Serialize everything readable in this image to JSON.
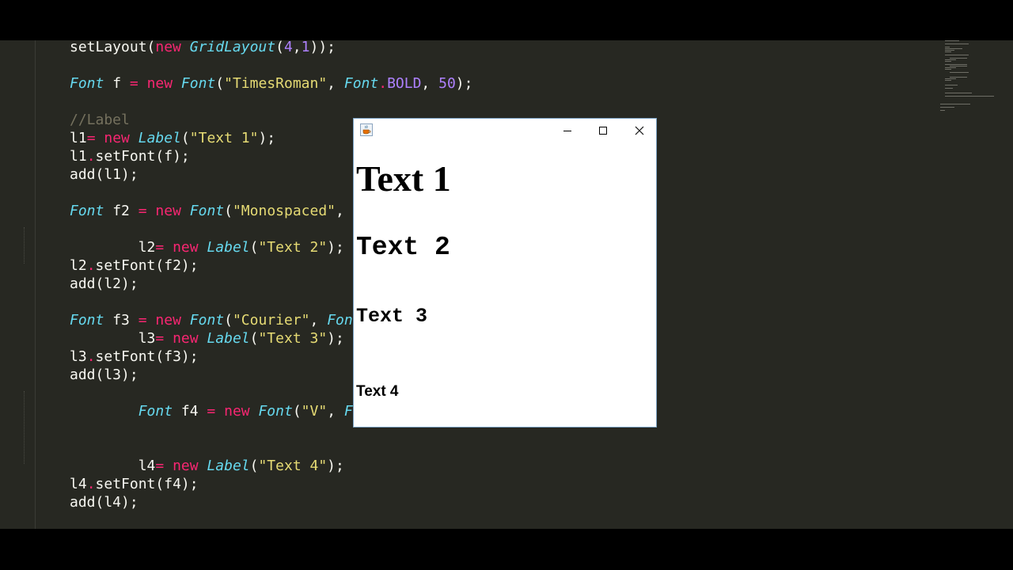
{
  "editor": {
    "lines": [
      {
        "indent": "",
        "tokens": [
          {
            "t": "setLayout("
          },
          {
            "t": "new",
            "c": "kw"
          },
          {
            "t": " "
          },
          {
            "t": "GridLayout",
            "c": "ty"
          },
          {
            "t": "("
          },
          {
            "t": "4",
            "c": "nu"
          },
          {
            "t": ","
          },
          {
            "t": "1",
            "c": "nu"
          },
          {
            "t": "));"
          }
        ]
      },
      {
        "indent": "",
        "tokens": []
      },
      {
        "indent": "",
        "tokens": [
          {
            "t": "Font",
            "c": "ty"
          },
          {
            "t": " f "
          },
          {
            "t": "=",
            "c": "kw"
          },
          {
            "t": " "
          },
          {
            "t": "new",
            "c": "kw"
          },
          {
            "t": " "
          },
          {
            "t": "Font",
            "c": "ty"
          },
          {
            "t": "("
          },
          {
            "t": "\"TimesRoman\"",
            "c": "st"
          },
          {
            "t": ", "
          },
          {
            "t": "Font",
            "c": "ty"
          },
          {
            "t": ".",
            "c": "kw"
          },
          {
            "t": "BOLD",
            "c": "nu"
          },
          {
            "t": ", "
          },
          {
            "t": "50",
            "c": "nu"
          },
          {
            "t": ");"
          }
        ]
      },
      {
        "indent": "",
        "tokens": []
      },
      {
        "indent": "",
        "tokens": [
          {
            "t": "//Label",
            "c": "cm"
          }
        ]
      },
      {
        "indent": "",
        "tokens": [
          {
            "t": "l1"
          },
          {
            "t": "=",
            "c": "kw"
          },
          {
            "t": " "
          },
          {
            "t": "new",
            "c": "kw"
          },
          {
            "t": " "
          },
          {
            "t": "Label",
            "c": "ty"
          },
          {
            "t": "("
          },
          {
            "t": "\"Text 1\"",
            "c": "st"
          },
          {
            "t": ");"
          }
        ]
      },
      {
        "indent": "",
        "tokens": [
          {
            "t": "l1"
          },
          {
            "t": ".",
            "c": "kw"
          },
          {
            "t": "setFont(f);"
          }
        ]
      },
      {
        "indent": "",
        "tokens": [
          {
            "t": "add(l1);"
          }
        ]
      },
      {
        "indent": "",
        "tokens": []
      },
      {
        "indent": "",
        "tokens": [
          {
            "t": "Font",
            "c": "ty"
          },
          {
            "t": " f2 "
          },
          {
            "t": "=",
            "c": "kw"
          },
          {
            "t": " "
          },
          {
            "t": "new",
            "c": "kw"
          },
          {
            "t": " "
          },
          {
            "t": "Font",
            "c": "ty"
          },
          {
            "t": "("
          },
          {
            "t": "\"Monospaced\"",
            "c": "st"
          },
          {
            "t": ","
          }
        ]
      },
      {
        "indent": "",
        "tokens": []
      },
      {
        "indent": "        ",
        "tokens": [
          {
            "t": "l2"
          },
          {
            "t": "=",
            "c": "kw"
          },
          {
            "t": " "
          },
          {
            "t": "new",
            "c": "kw"
          },
          {
            "t": " "
          },
          {
            "t": "Label",
            "c": "ty"
          },
          {
            "t": "("
          },
          {
            "t": "\"Text 2\"",
            "c": "st"
          },
          {
            "t": ");"
          }
        ]
      },
      {
        "indent": "",
        "tokens": [
          {
            "t": "l2"
          },
          {
            "t": ".",
            "c": "kw"
          },
          {
            "t": "setFont(f2);"
          }
        ]
      },
      {
        "indent": "",
        "tokens": [
          {
            "t": "add(l2);"
          }
        ]
      },
      {
        "indent": "",
        "tokens": []
      },
      {
        "indent": "",
        "tokens": [
          {
            "t": "Font",
            "c": "ty"
          },
          {
            "t": " f3 "
          },
          {
            "t": "=",
            "c": "kw"
          },
          {
            "t": " "
          },
          {
            "t": "new",
            "c": "kw"
          },
          {
            "t": " "
          },
          {
            "t": "Font",
            "c": "ty"
          },
          {
            "t": "("
          },
          {
            "t": "\"Courier\"",
            "c": "st"
          },
          {
            "t": ", "
          },
          {
            "t": "Font",
            "c": "ty"
          }
        ]
      },
      {
        "indent": "        ",
        "tokens": [
          {
            "t": "l3"
          },
          {
            "t": "=",
            "c": "kw"
          },
          {
            "t": " "
          },
          {
            "t": "new",
            "c": "kw"
          },
          {
            "t": " "
          },
          {
            "t": "Label",
            "c": "ty"
          },
          {
            "t": "("
          },
          {
            "t": "\"Text 3\"",
            "c": "st"
          },
          {
            "t": ");"
          }
        ]
      },
      {
        "indent": "",
        "tokens": [
          {
            "t": "l3"
          },
          {
            "t": ".",
            "c": "kw"
          },
          {
            "t": "setFont(f3);"
          }
        ]
      },
      {
        "indent": "",
        "tokens": [
          {
            "t": "add(l3);"
          }
        ]
      },
      {
        "indent": "",
        "tokens": []
      },
      {
        "indent": "        ",
        "tokens": [
          {
            "t": "Font",
            "c": "ty"
          },
          {
            "t": " f4 "
          },
          {
            "t": "=",
            "c": "kw"
          },
          {
            "t": " "
          },
          {
            "t": "new",
            "c": "kw"
          },
          {
            "t": " "
          },
          {
            "t": "Font",
            "c": "ty"
          },
          {
            "t": "("
          },
          {
            "t": "\"V\"",
            "c": "st"
          },
          {
            "t": ", "
          },
          {
            "t": "F",
            "c": "ty"
          }
        ]
      },
      {
        "indent": "",
        "tokens": []
      },
      {
        "indent": "",
        "tokens": []
      },
      {
        "indent": "        ",
        "tokens": [
          {
            "t": "l4"
          },
          {
            "t": "=",
            "c": "kw"
          },
          {
            "t": " "
          },
          {
            "t": "new",
            "c": "kw"
          },
          {
            "t": " "
          },
          {
            "t": "Label",
            "c": "ty"
          },
          {
            "t": "("
          },
          {
            "t": "\"Text 4\"",
            "c": "st"
          },
          {
            "t": ");"
          }
        ]
      },
      {
        "indent": "",
        "tokens": [
          {
            "t": "l4"
          },
          {
            "t": ".",
            "c": "kw"
          },
          {
            "t": "setFont(f4);"
          }
        ]
      },
      {
        "indent": "",
        "tokens": [
          {
            "t": "add(l4);"
          }
        ]
      }
    ]
  },
  "window": {
    "icon": "java-cup-icon",
    "controls": {
      "minimize": "minimize-icon",
      "maximize": "maximize-icon",
      "close": "close-icon"
    },
    "labels": [
      "Text 1",
      "Text 2",
      "Text 3",
      "Text 4"
    ]
  },
  "colors": {
    "editor_bg": "#272822",
    "keyword": "#f92672",
    "type": "#66d9ef",
    "string": "#e6db74",
    "number": "#ae81ff",
    "comment": "#75715e",
    "plain": "#f8f8f2"
  }
}
